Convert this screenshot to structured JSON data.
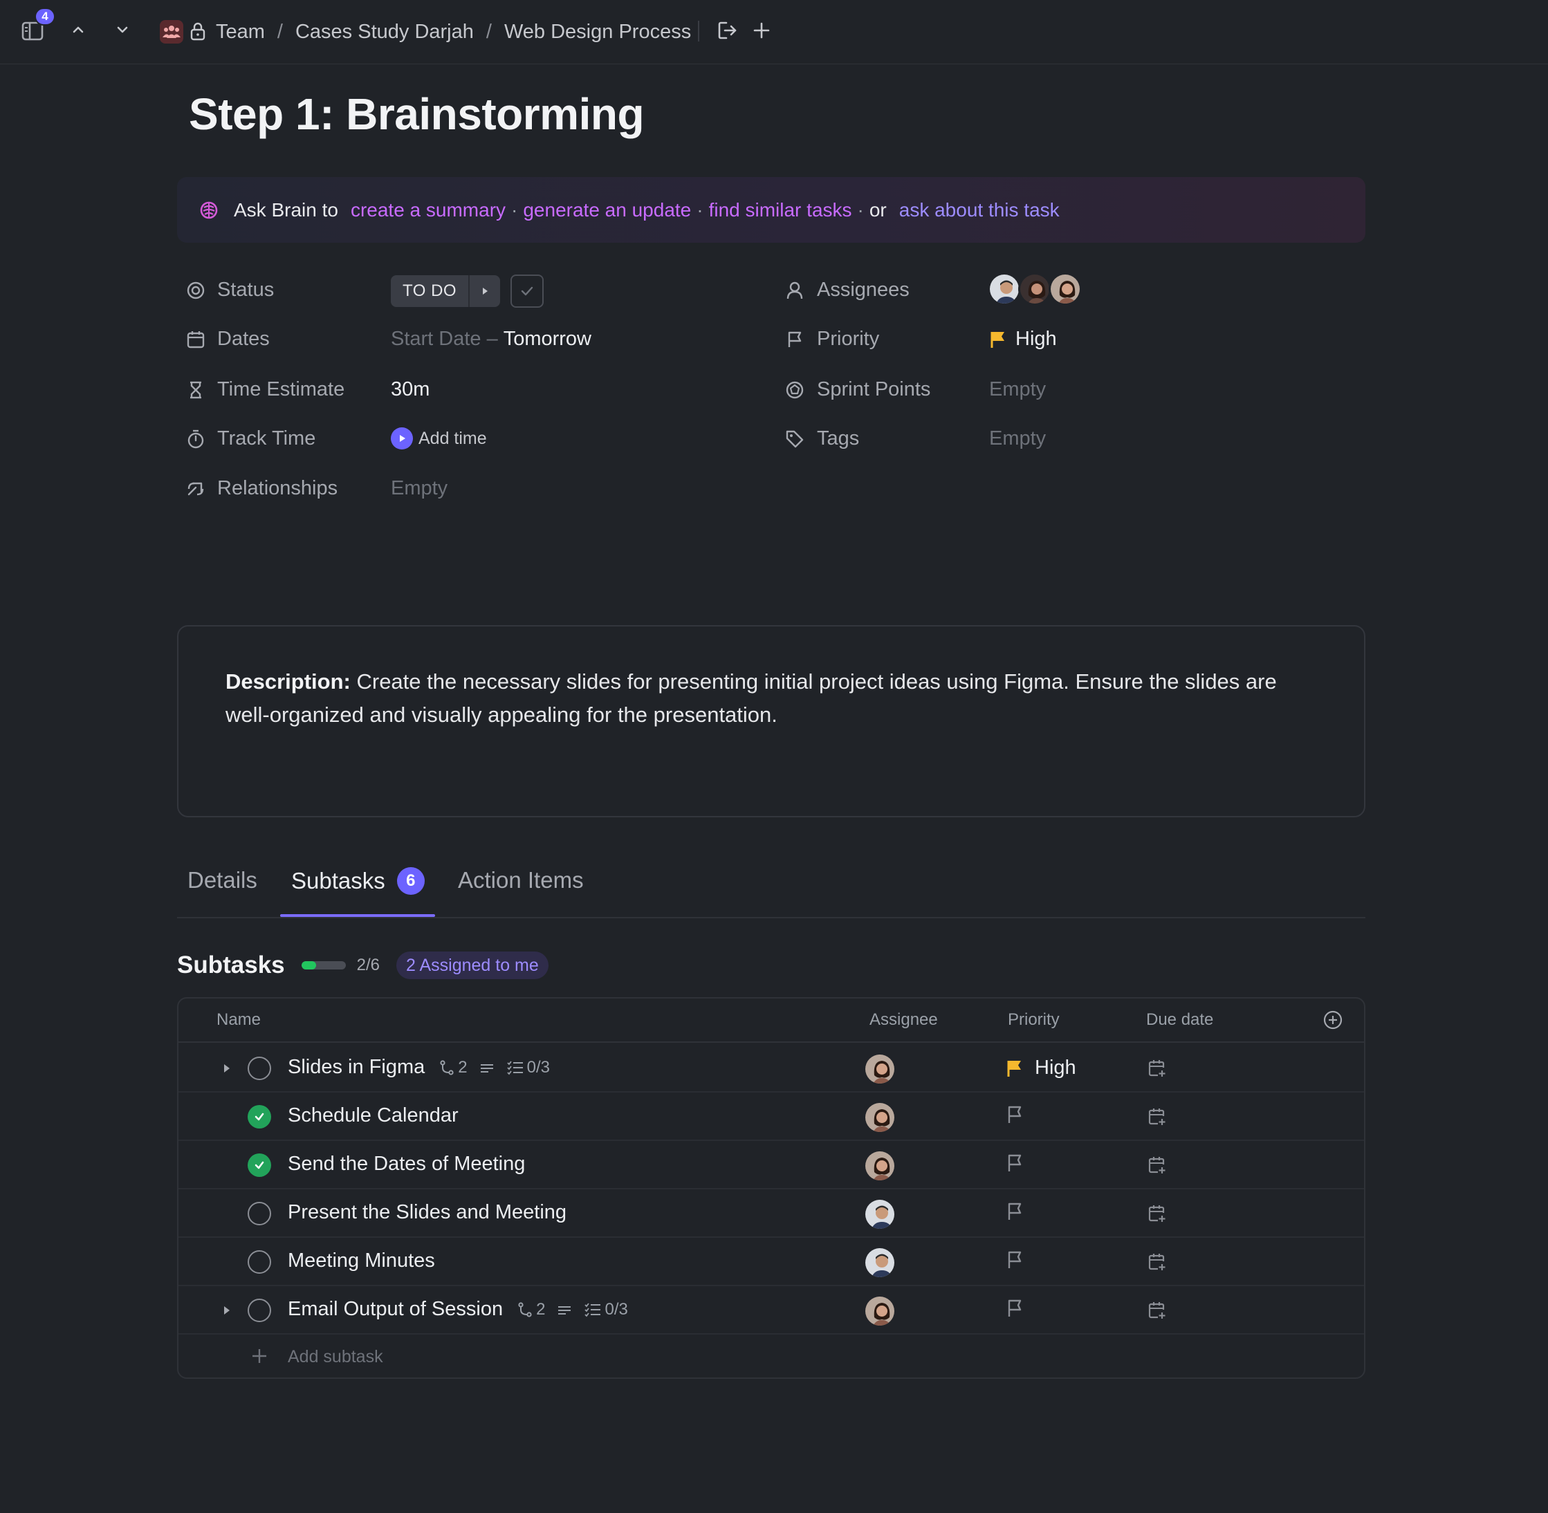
{
  "topbar": {
    "notification_count": "4",
    "breadcrumb": [
      "Team",
      "Cases Study Darjah",
      "Web Design Process"
    ],
    "separator": "/"
  },
  "task": {
    "title": "Step 1: Brainstorming"
  },
  "brain": {
    "prefix": "Ask Brain to",
    "link1": "create a summary",
    "link2": "generate an update",
    "link3": "find similar tasks",
    "or": "or",
    "link4": "ask about this task",
    "dot": "·"
  },
  "fields": {
    "status": {
      "label": "Status",
      "value": "TO DO"
    },
    "dates": {
      "label": "Dates",
      "start": "Start Date",
      "dash": "–",
      "end": "Tomorrow"
    },
    "time_estimate": {
      "label": "Time Estimate",
      "value": "30m"
    },
    "track_time": {
      "label": "Track Time",
      "value": "Add time"
    },
    "relationships": {
      "label": "Relationships",
      "value": "Empty"
    },
    "assignees": {
      "label": "Assignees"
    },
    "priority": {
      "label": "Priority",
      "value": "High"
    },
    "sprint_points": {
      "label": "Sprint Points",
      "value": "Empty"
    },
    "tags": {
      "label": "Tags",
      "value": "Empty"
    }
  },
  "description": {
    "label": "Description:",
    "text": "Create the necessary slides for presenting initial project ideas using Figma. Ensure the slides are well-organized and visually appealing for the presentation."
  },
  "tabs": [
    {
      "label": "Details"
    },
    {
      "label": "Subtasks",
      "count": "6"
    },
    {
      "label": "Action Items"
    }
  ],
  "subtasks": {
    "heading": "Subtasks",
    "progress_text": "2/6",
    "progress_fraction": 0.333,
    "assigned_badge": "2 Assigned to me",
    "columns": {
      "name": "Name",
      "assignee": "Assignee",
      "priority": "Priority",
      "due": "Due date"
    },
    "rows": [
      {
        "name": "Slides in Figma",
        "done": false,
        "expandable": true,
        "deps": "2",
        "checklist": "0/3",
        "priority": "High",
        "avatar": "female"
      },
      {
        "name": "Schedule Calendar",
        "done": true,
        "expandable": false,
        "priority": "",
        "avatar": "female"
      },
      {
        "name": "Send the Dates of Meeting",
        "done": true,
        "expandable": false,
        "priority": "",
        "avatar": "female"
      },
      {
        "name": "Present the Slides and Meeting",
        "done": false,
        "expandable": false,
        "priority": "",
        "avatar": "male"
      },
      {
        "name": "Meeting Minutes",
        "done": false,
        "expandable": false,
        "priority": "",
        "avatar": "male"
      },
      {
        "name": "Email Output of Session",
        "done": false,
        "expandable": true,
        "deps": "2",
        "checklist": "0/3",
        "priority": "",
        "avatar": "female"
      }
    ],
    "add_label": "Add subtask"
  },
  "colors": {
    "accent": "#6c63ff",
    "brain_link": "#c86bff",
    "priority_high": "#f5b82e",
    "done_green": "#22a35a",
    "background": "#202328"
  }
}
